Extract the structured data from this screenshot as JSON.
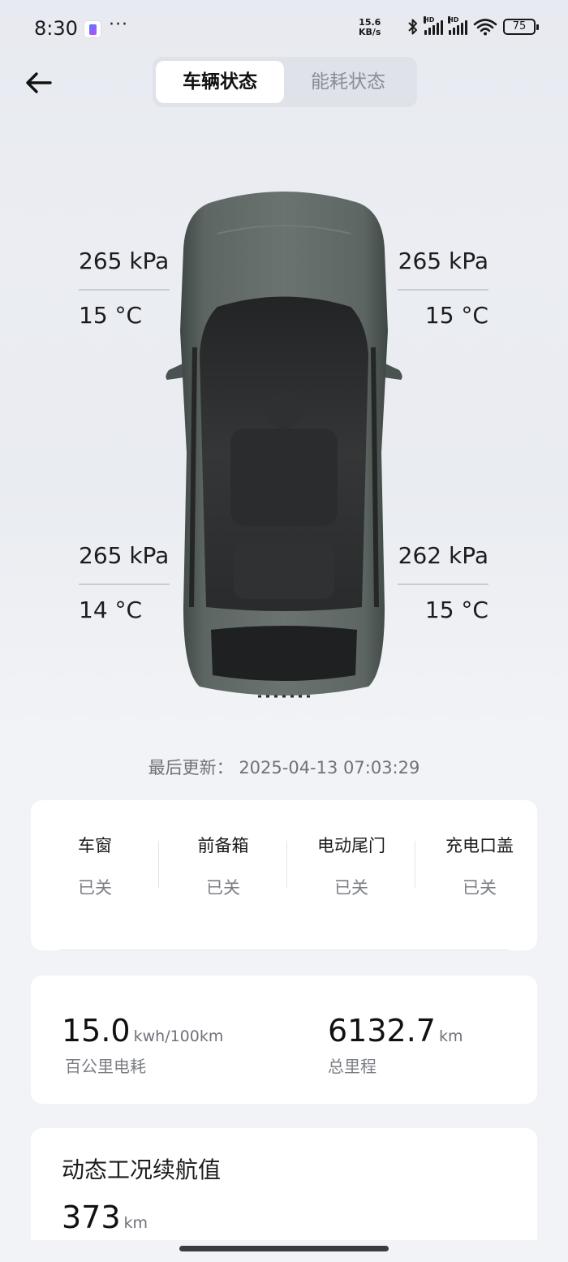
{
  "status_bar": {
    "time": "8:30",
    "dots": "···",
    "speed_value": "15.6",
    "speed_unit": "KB/s",
    "hd1": "HD",
    "hd2": "HD",
    "battery": "75",
    "icons": [
      "app-icon",
      "bluetooth-icon",
      "signal-icon",
      "signal-icon",
      "wifi-icon",
      "battery-icon"
    ]
  },
  "header": {
    "back_icon": "arrow-left-icon",
    "tabs": [
      {
        "label": "车辆状态",
        "active": true
      },
      {
        "label": "能耗状态",
        "active": false
      }
    ]
  },
  "tires": {
    "front_left": {
      "pressure": "265 kPa",
      "temp": "15 °C"
    },
    "front_right": {
      "pressure": "265 kPa",
      "temp": "15 °C"
    },
    "rear_left": {
      "pressure": "265 kPa",
      "temp": "14 °C"
    },
    "rear_right": {
      "pressure": "262 kPa",
      "temp": "15 °C"
    }
  },
  "car": {
    "color": "#5b6461",
    "roof_color": "#2e2f30"
  },
  "last_update": {
    "label": "最后更新：",
    "value": "2025-04-13 07:03:29"
  },
  "status_items": [
    {
      "name": "车窗",
      "value": "已关"
    },
    {
      "name": "前备箱",
      "value": "已关"
    },
    {
      "name": "电动尾门",
      "value": "已关"
    },
    {
      "name": "充电口盖",
      "value": "已关"
    }
  ],
  "metrics": {
    "consumption": {
      "value": "15.0",
      "unit": "kwh/100km",
      "label": "百公里电耗"
    },
    "odometer": {
      "value": "6132.7",
      "unit": "km",
      "label": "总里程"
    }
  },
  "range": {
    "title": "动态工况续航值",
    "value": "373",
    "unit": "km"
  }
}
